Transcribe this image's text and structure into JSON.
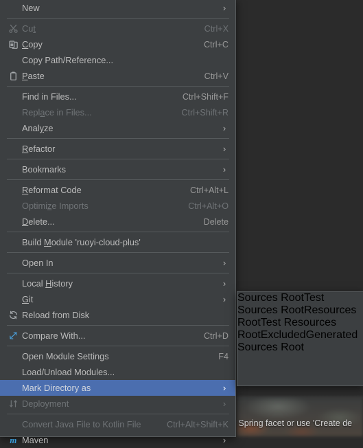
{
  "app": {
    "theme_bg": "#3c3f41",
    "accent_selection": "#4b6eaf",
    "text_color": "#bbbbbb",
    "disabled_color": "#6f7376",
    "separator_color": "#565a5c"
  },
  "backdrop": {
    "status_text": "e Spring facet or use 'Create de"
  },
  "context_menu": {
    "name": "project-context-menu",
    "groups": [
      {
        "items": [
          {
            "label": "New",
            "mnemonic": "",
            "accelerator": "",
            "submenu": true,
            "icon": "",
            "disabled": false,
            "selected": false
          }
        ]
      },
      {
        "items": [
          {
            "label": "Cut",
            "mnemonic": "t",
            "accelerator": "Ctrl+X",
            "submenu": false,
            "icon": "scissors-icon",
            "disabled": true,
            "selected": false
          },
          {
            "label": "Copy",
            "mnemonic": "C",
            "accelerator": "Ctrl+C",
            "submenu": false,
            "icon": "copy-icon",
            "disabled": false,
            "selected": false
          },
          {
            "label": "Copy Path/Reference...",
            "mnemonic": "",
            "accelerator": "",
            "submenu": false,
            "icon": "",
            "disabled": false,
            "selected": false
          },
          {
            "label": "Paste",
            "mnemonic": "P",
            "accelerator": "Ctrl+V",
            "submenu": false,
            "icon": "clipboard-icon",
            "disabled": false,
            "selected": false
          }
        ]
      },
      {
        "items": [
          {
            "label": "Find in Files...",
            "mnemonic": "",
            "accelerator": "Ctrl+Shift+F",
            "submenu": false,
            "icon": "",
            "disabled": false,
            "selected": false
          },
          {
            "label": "Replace in Files...",
            "mnemonic": "a",
            "accelerator": "Ctrl+Shift+R",
            "submenu": false,
            "icon": "",
            "disabled": true,
            "selected": false
          },
          {
            "label": "Analyze",
            "mnemonic": "y",
            "accelerator": "",
            "submenu": true,
            "icon": "",
            "disabled": false,
            "selected": false
          }
        ]
      },
      {
        "items": [
          {
            "label": "Refactor",
            "mnemonic": "R",
            "accelerator": "",
            "submenu": true,
            "icon": "",
            "disabled": false,
            "selected": false
          }
        ]
      },
      {
        "items": [
          {
            "label": "Bookmarks",
            "mnemonic": "",
            "accelerator": "",
            "submenu": true,
            "icon": "",
            "disabled": false,
            "selected": false
          }
        ]
      },
      {
        "items": [
          {
            "label": "Reformat Code",
            "mnemonic": "R",
            "accelerator": "Ctrl+Alt+L",
            "submenu": false,
            "icon": "",
            "disabled": false,
            "selected": false
          },
          {
            "label": "Optimize Imports",
            "mnemonic": "z",
            "accelerator": "Ctrl+Alt+O",
            "submenu": false,
            "icon": "",
            "disabled": true,
            "selected": false
          },
          {
            "label": "Delete...",
            "mnemonic": "D",
            "accelerator": "Delete",
            "submenu": false,
            "icon": "",
            "disabled": false,
            "selected": false
          }
        ]
      },
      {
        "items": [
          {
            "label": "Build Module 'ruoyi-cloud-plus'",
            "mnemonic": "M",
            "accelerator": "",
            "submenu": false,
            "icon": "",
            "disabled": false,
            "selected": false
          }
        ]
      },
      {
        "items": [
          {
            "label": "Open In",
            "mnemonic": "",
            "accelerator": "",
            "submenu": true,
            "icon": "",
            "disabled": false,
            "selected": false
          }
        ]
      },
      {
        "items": [
          {
            "label": "Local History",
            "mnemonic": "H",
            "accelerator": "",
            "submenu": true,
            "icon": "",
            "disabled": false,
            "selected": false
          },
          {
            "label": "Git",
            "mnemonic": "G",
            "accelerator": "",
            "submenu": true,
            "icon": "",
            "disabled": false,
            "selected": false
          },
          {
            "label": "Reload from Disk",
            "mnemonic": "",
            "accelerator": "",
            "submenu": false,
            "icon": "refresh-icon",
            "disabled": false,
            "selected": false
          }
        ]
      },
      {
        "items": [
          {
            "label": "Compare With...",
            "mnemonic": "",
            "accelerator": "Ctrl+D",
            "submenu": false,
            "icon": "compare-icon",
            "disabled": false,
            "selected": false
          }
        ]
      },
      {
        "items": [
          {
            "label": "Open Module Settings",
            "mnemonic": "",
            "accelerator": "F4",
            "submenu": false,
            "icon": "",
            "disabled": false,
            "selected": false
          },
          {
            "label": "Load/Unload Modules...",
            "mnemonic": "",
            "accelerator": "",
            "submenu": false,
            "icon": "",
            "disabled": false,
            "selected": false
          },
          {
            "label": "Mark Directory as",
            "mnemonic": "",
            "accelerator": "",
            "submenu": true,
            "icon": "",
            "disabled": false,
            "selected": true
          },
          {
            "label": "Deployment",
            "mnemonic": "",
            "accelerator": "",
            "submenu": true,
            "icon": "deployment-icon",
            "disabled": true,
            "selected": false
          }
        ]
      },
      {
        "items": [
          {
            "label": "Convert Java File to Kotlin File",
            "mnemonic": "",
            "accelerator": "Ctrl+Alt+Shift+K",
            "submenu": false,
            "icon": "",
            "disabled": true,
            "selected": false
          },
          {
            "label": "Maven",
            "mnemonic": "",
            "accelerator": "",
            "submenu": true,
            "icon": "maven-icon",
            "disabled": false,
            "selected": false
          }
        ]
      }
    ]
  },
  "sub_menu": {
    "name": "mark-directory-as-submenu",
    "items": [
      {
        "label": "Sources Root",
        "icon": "sources-root-folder-icon",
        "icon_color": "#3592c4",
        "selected": false
      },
      {
        "label": "Test Sources Root",
        "icon": "test-sources-root-folder-icon",
        "icon_color": "#5a9e3f",
        "selected": false
      },
      {
        "label": "Resources Root",
        "icon": "resources-root-folder-icon",
        "icon_color": "#9aa0a6",
        "selected": false
      },
      {
        "label": "Test Resources Root",
        "icon": "test-resources-root-folder-icon",
        "icon_color": "#9aa0a6",
        "selected": false
      },
      {
        "label": "Excluded",
        "icon": "excluded-folder-icon",
        "icon_color": "#c0622c",
        "selected": true
      },
      {
        "label": "Generated Sources Root",
        "icon": "generated-sources-root-folder-icon",
        "icon_color": "#3592c4",
        "selected": false
      }
    ]
  }
}
